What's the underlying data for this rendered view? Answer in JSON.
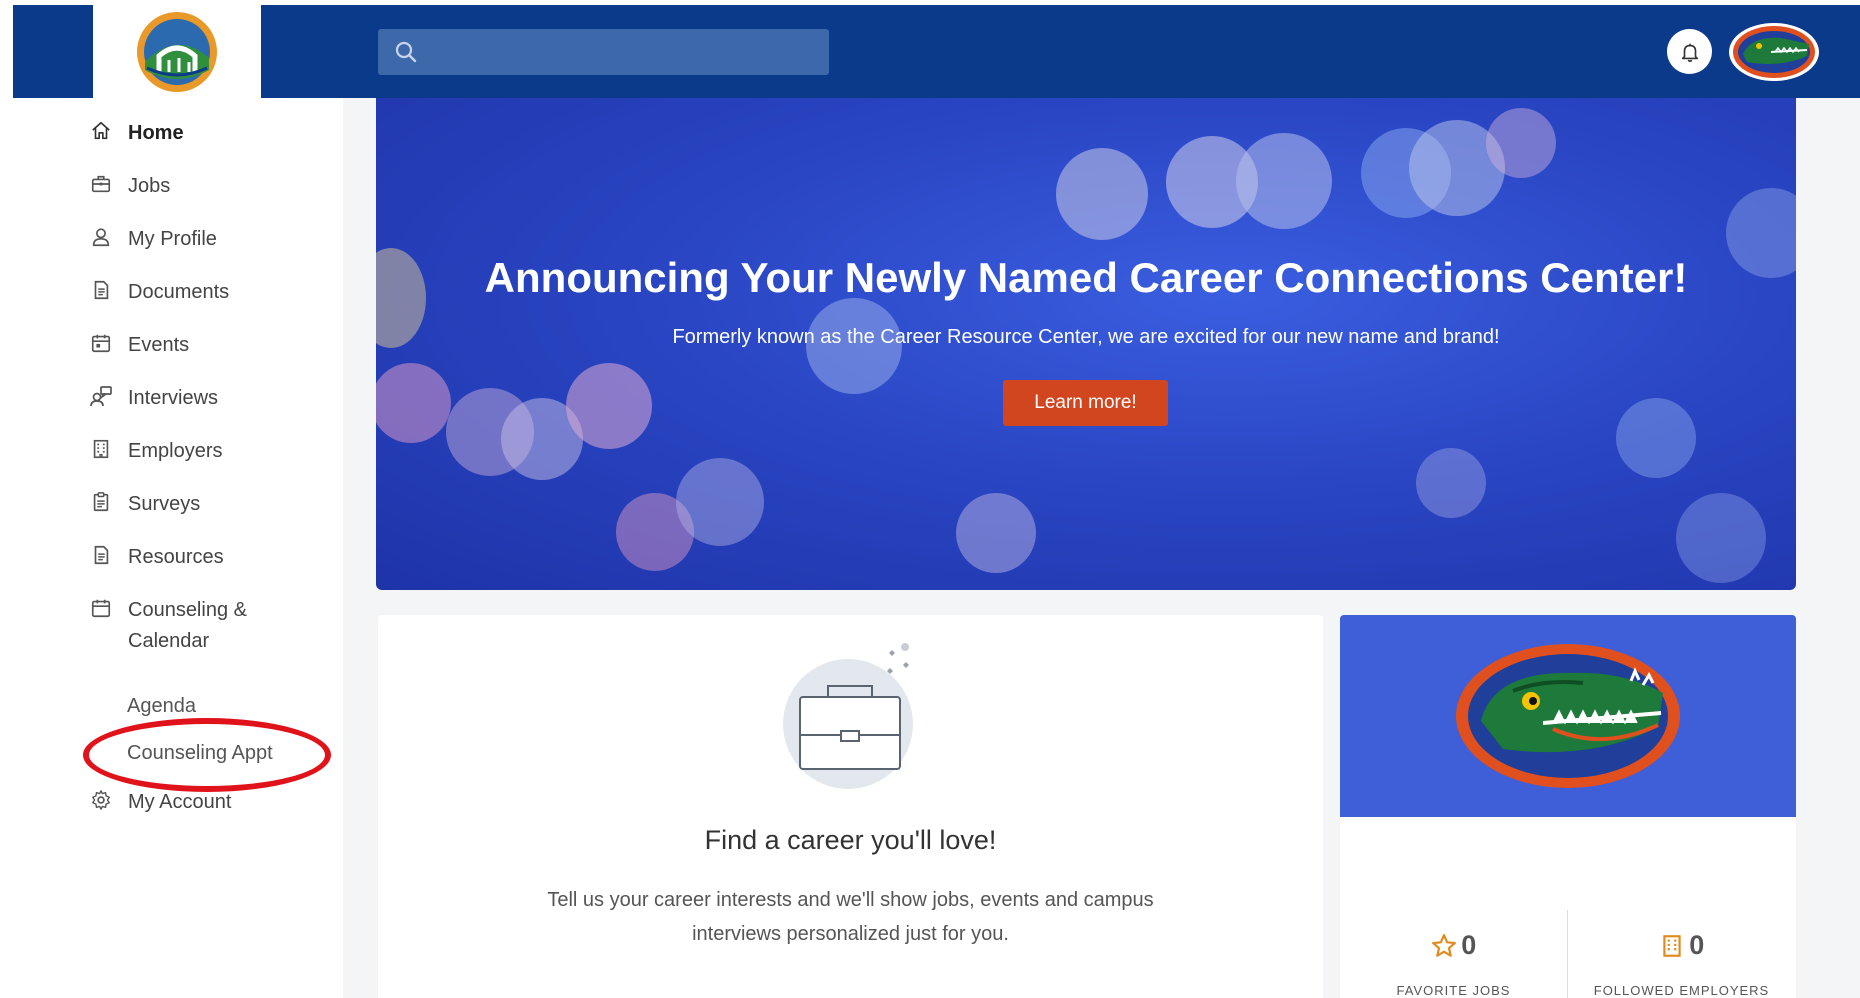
{
  "header": {
    "search": {
      "placeholder": "",
      "value": ""
    },
    "icons": [
      "search-icon",
      "bell-icon",
      "gator-avatar-icon"
    ]
  },
  "sidebar": {
    "items": [
      {
        "label": "Home",
        "icon": "home-icon"
      },
      {
        "label": "Jobs",
        "icon": "briefcase-icon"
      },
      {
        "label": "My Profile",
        "icon": "person-icon"
      },
      {
        "label": "Documents",
        "icon": "document-icon"
      },
      {
        "label": "Events",
        "icon": "calendar-icon"
      },
      {
        "label": "Interviews",
        "icon": "interview-icon"
      },
      {
        "label": "Employers",
        "icon": "building-icon"
      },
      {
        "label": "Surveys",
        "icon": "clipboard-icon"
      },
      {
        "label": "Resources",
        "icon": "document-icon"
      },
      {
        "label": "Counseling & Calendar",
        "line1": "Counseling &",
        "line2": "Calendar",
        "icon": "calendar-icon"
      },
      {
        "label": "My Account",
        "icon": "gear-icon"
      }
    ],
    "sub_items": [
      {
        "label": "Agenda"
      },
      {
        "label": "Counseling Appt"
      }
    ],
    "active": "Home",
    "highlight_color": "#e0121a"
  },
  "hero": {
    "title": "Announcing Your Newly Named Career Connections Center!",
    "subtitle": "Formerly known as the Career Resource Center, we are excited for our new name and brand!",
    "button_label": "Learn more!",
    "button_color": "#d2461f"
  },
  "career_card": {
    "title": "Find a career you'll love!",
    "text_line1": "Tell us your career interests and we'll show jobs, events and campus",
    "text_line2": "interviews personalized just for you."
  },
  "stats_card": {
    "favorite_jobs": {
      "value": "0",
      "label": "FAVORITE JOBS",
      "icon": "star-icon"
    },
    "followed_employers": {
      "value": "0",
      "label": "FOLLOWED EMPLOYERS",
      "icon": "building-icon"
    }
  },
  "colors": {
    "brand_blue": "#0b3a8a",
    "accent_orange": "#e08a1e",
    "gator_green": "#1d7a3a"
  }
}
